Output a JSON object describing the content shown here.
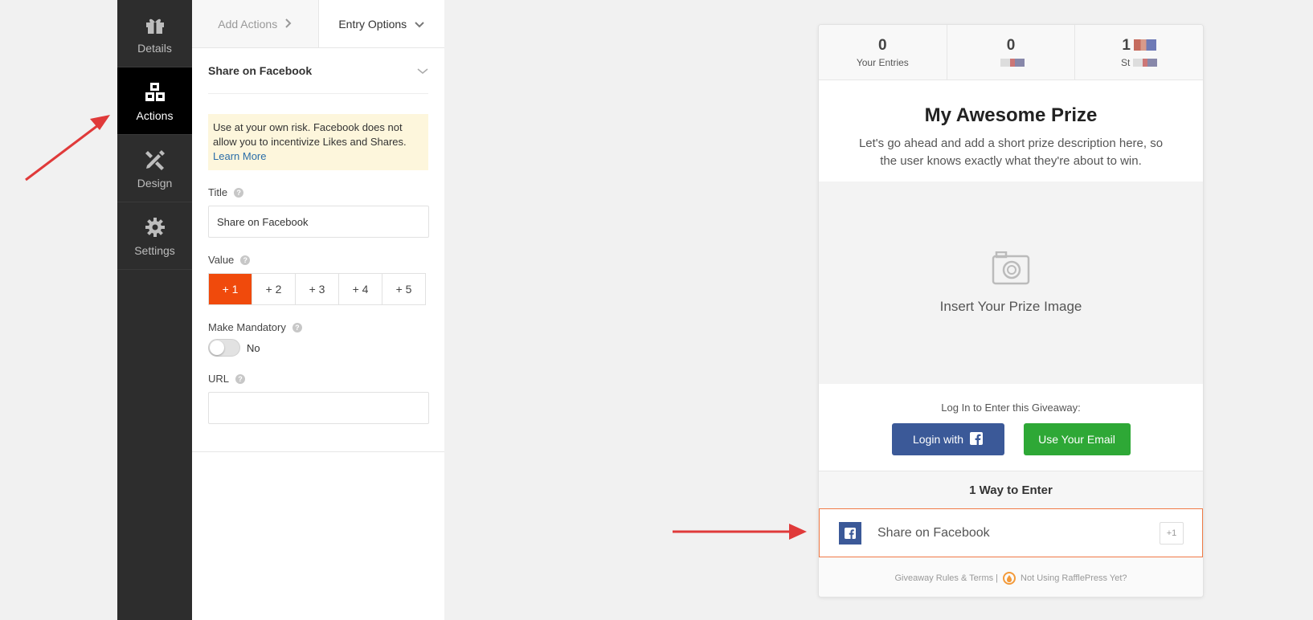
{
  "sidebar": {
    "items": [
      {
        "label": "Details",
        "icon": "gift-icon"
      },
      {
        "label": "Actions",
        "icon": "cubes-icon"
      },
      {
        "label": "Design",
        "icon": "pencil-ruler-icon"
      },
      {
        "label": "Settings",
        "icon": "gear-icon"
      }
    ],
    "active": "Actions"
  },
  "panel": {
    "tabs": {
      "add_actions": "Add Actions",
      "entry_options": "Entry Options"
    },
    "section_title": "Share on Facebook",
    "warning": {
      "text": "Use at your own risk. Facebook does not allow you to incentivize Likes and Shares.",
      "link": "Learn More"
    },
    "title_field": {
      "label": "Title",
      "value": "Share on Facebook"
    },
    "value_field": {
      "label": "Value",
      "options": [
        "+ 1",
        "+ 2",
        "+ 3",
        "+ 4",
        "+ 5"
      ],
      "selected": "+ 1"
    },
    "mandatory": {
      "label": "Make Mandatory",
      "state": "No"
    },
    "url_field": {
      "label": "URL",
      "value": ""
    }
  },
  "preview": {
    "stats": [
      {
        "value": "0",
        "label": "Your Entries"
      },
      {
        "value": "0",
        "label": ""
      },
      {
        "value": "1",
        "label": "St"
      }
    ],
    "prize_title": "My Awesome Prize",
    "prize_description": "Let's go ahead and add a short prize description here, so the user knows exactly what they're about to win.",
    "prize_image_text": "Insert Your Prize Image",
    "login_text": "Log In to Enter this Giveaway:",
    "login_facebook": "Login with",
    "login_email": "Use Your Email",
    "ways_to_enter": "1 Way to Enter",
    "entry": {
      "label": "Share on Facebook",
      "points": "+1"
    },
    "footer": {
      "rules": "Giveaway Rules & Terms |",
      "promo": "Not Using RafflePress Yet?"
    }
  },
  "colors": {
    "sidebar_bg": "#2d2d2d",
    "accent_orange": "#f04a0c",
    "facebook_blue": "#3b5998",
    "email_green": "#2ea836",
    "annotation_red": "#e03a3a"
  }
}
